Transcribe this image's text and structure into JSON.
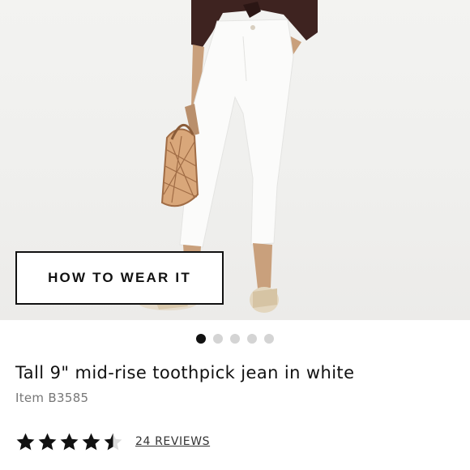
{
  "hero": {
    "cta_label": "HOW TO WEAR IT",
    "total_images": 5,
    "active_image": 1
  },
  "product": {
    "title": "Tall 9\" mid-rise toothpick jean in white",
    "item_number": "Item B3585"
  },
  "rating": {
    "stars": 4.5,
    "max_stars": 5,
    "reviews_label": "24 REVIEWS"
  },
  "colors": {
    "accent": "#111111",
    "dot_inactive": "#d4d4d4",
    "muted_text": "#777777"
  }
}
